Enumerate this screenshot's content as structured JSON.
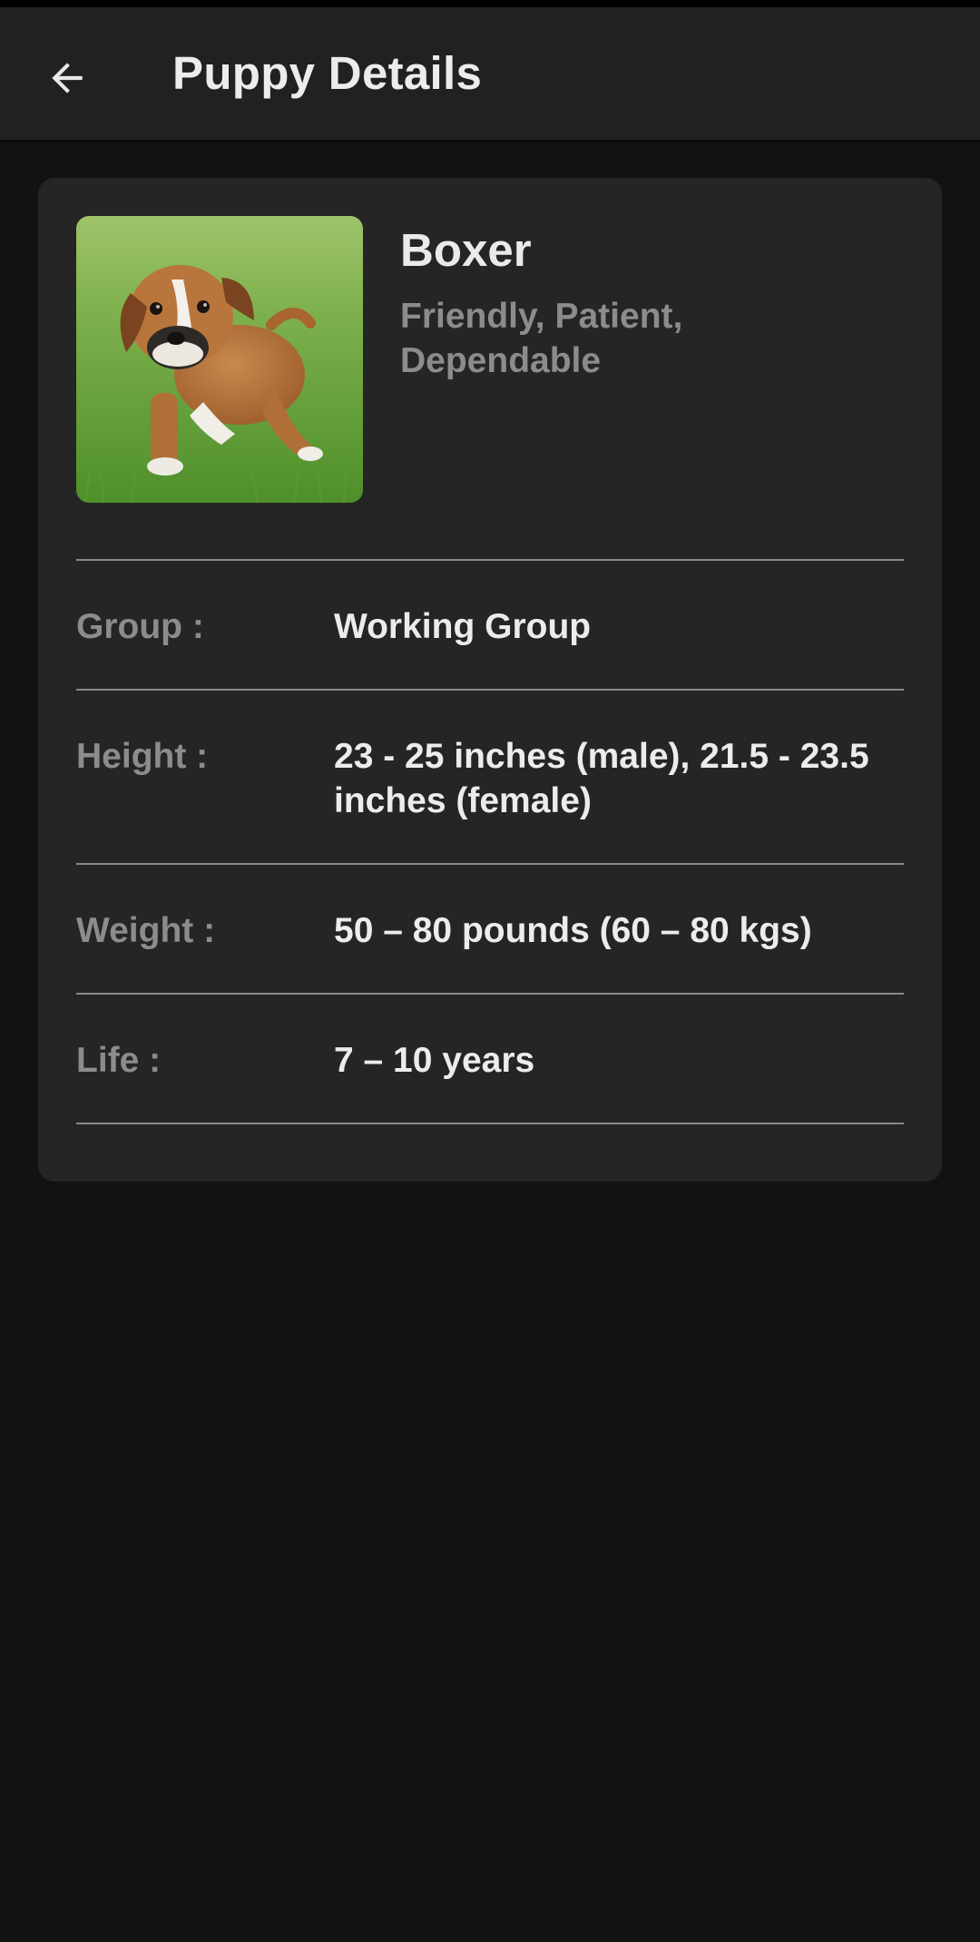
{
  "app_bar": {
    "title": "Puppy Details",
    "back_icon": "arrow-left-icon"
  },
  "puppy": {
    "name": "Boxer",
    "temperament": "Friendly, Patient, Dependable",
    "photo_alt": "boxer-puppy-photo"
  },
  "details": [
    {
      "label": "Group :",
      "value": "Working Group"
    },
    {
      "label": "Height :",
      "value": "23 - 25 inches (male), 21.5 - 23.5 inches (female)"
    },
    {
      "label": "Weight :",
      "value": "50 – 80 pounds (60 – 80 kgs)"
    },
    {
      "label": "Life :",
      "value": "7 – 10 years"
    }
  ],
  "colors": {
    "background": "#121212",
    "app_bar": "#212121",
    "card": "#252525",
    "primary_text": "#ECECEC",
    "secondary_text": "#8C8C8C",
    "divider": "#8A8A8A"
  }
}
